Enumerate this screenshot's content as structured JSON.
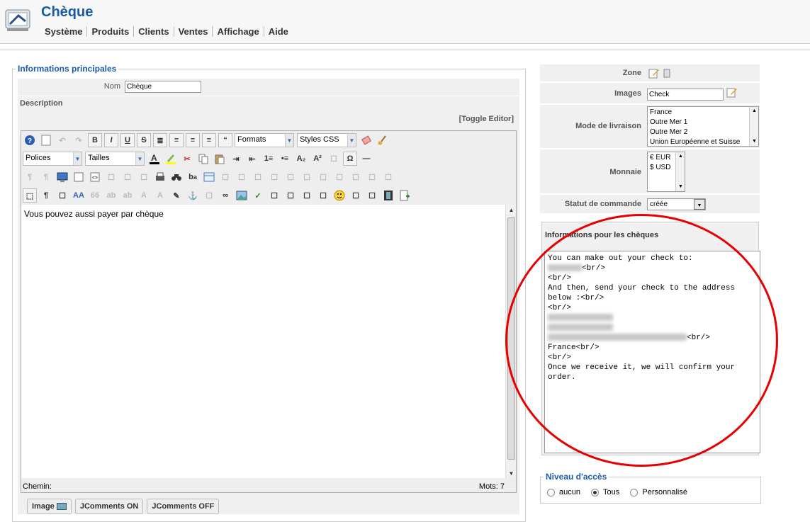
{
  "app": {
    "title": "Chèque"
  },
  "nav": [
    "Système",
    "Produits",
    "Clients",
    "Ventes",
    "Affichage",
    "Aide"
  ],
  "main_fieldset": {
    "legend": "Informations principales"
  },
  "nom": {
    "label": "Nom",
    "value": "Chèque"
  },
  "description": {
    "label": "Description",
    "toggle": "[Toggle Editor]"
  },
  "toolbar": {
    "formats": "Formats",
    "styles": "Styles CSS",
    "polices": "Polices",
    "tailles": "Tailles"
  },
  "editor": {
    "content": "Vous pouvez aussi payer par chèque",
    "path_label": "Chemin:",
    "word_count": "Mots: 7"
  },
  "buttons": {
    "image": "Image",
    "jc_on": "JComments ON",
    "jc_off": "JComments OFF"
  },
  "zone": {
    "label": "Zone"
  },
  "images": {
    "label": "Images",
    "value": "Check"
  },
  "livraison": {
    "label": "Mode de livraison",
    "options": [
      "France",
      "Outre Mer 1",
      "Outre Mer 2",
      "Union Européenne et Suisse"
    ]
  },
  "monnaie": {
    "label": "Monnaie",
    "options": [
      "€ EUR",
      "$ USD"
    ]
  },
  "statut": {
    "label": "Statut de commande",
    "value": "créée"
  },
  "cheques": {
    "title": "Informations pour les chèques",
    "lines": [
      "You can make out your check to:",
      "<br/>",
      "<br/>",
      "And then, send your check to the address",
      "below :<br/>",
      "<br/>",
      "<br/>",
      "France<br/>",
      "<br/>",
      "Once we receive it, we will confirm your",
      "order."
    ]
  },
  "niveau": {
    "legend": "Niveau d'accès",
    "options": [
      "aucun",
      "Tous",
      "Personnalisé"
    ],
    "selected": "Tous"
  },
  "colors": {
    "accent": "#1a5aa6",
    "highlight_circle": "#e60000"
  }
}
